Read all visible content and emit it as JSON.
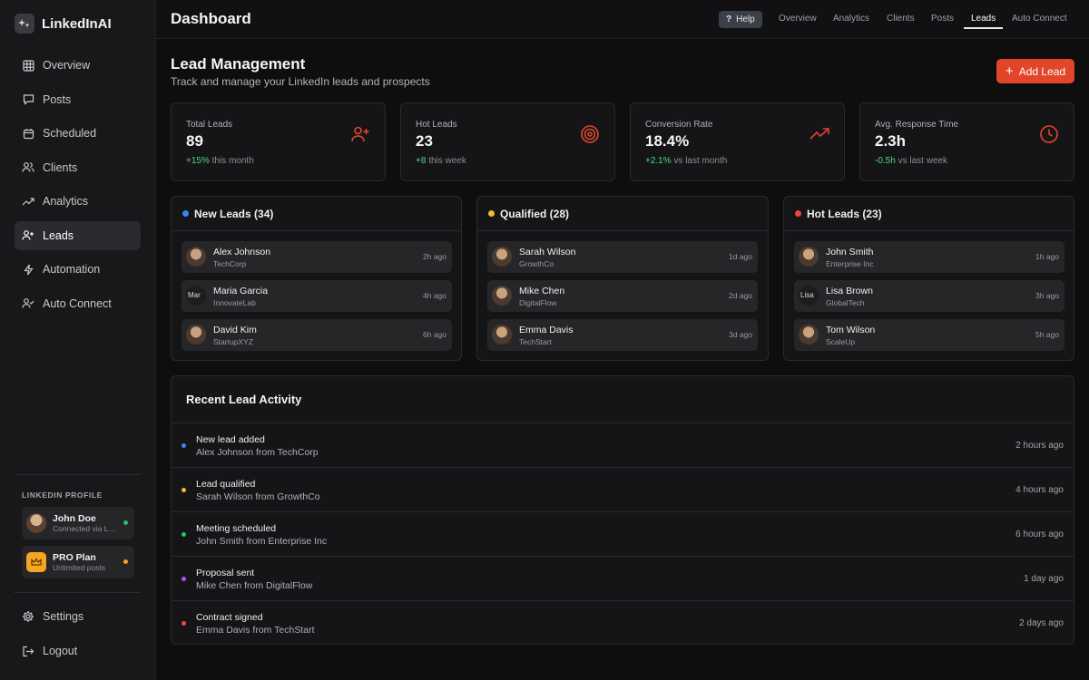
{
  "brand": {
    "name": "LinkedInAI",
    "logo_icon": "sparkle-icon"
  },
  "sidebar": {
    "items": [
      {
        "label": "Overview",
        "icon": "grid-icon",
        "active": false
      },
      {
        "label": "Posts",
        "icon": "chat-bubble-icon",
        "active": false
      },
      {
        "label": "Scheduled",
        "icon": "calendar-icon",
        "active": false
      },
      {
        "label": "Clients",
        "icon": "users-icon",
        "active": false
      },
      {
        "label": "Analytics",
        "icon": "trend-icon",
        "active": false
      },
      {
        "label": "Leads",
        "icon": "user-plus-icon",
        "active": true
      },
      {
        "label": "Automation",
        "icon": "lightning-icon",
        "active": false
      },
      {
        "label": "Auto Connect",
        "icon": "user-check-icon",
        "active": false
      }
    ],
    "profile_section_label": "LINKEDIN PROFILE",
    "profile": {
      "name": "John Doe",
      "status": "Connected via LinkedIn",
      "status_color": "#22c55e"
    },
    "plan": {
      "name": "PRO Plan",
      "detail": "Unlimited posts",
      "status_color": "#f5a623"
    },
    "settings_label": "Settings",
    "logout_label": "Logout"
  },
  "header": {
    "title": "Dashboard",
    "help_label": "Help",
    "tabs": [
      {
        "label": "Overview",
        "active": false
      },
      {
        "label": "Analytics",
        "active": false
      },
      {
        "label": "Clients",
        "active": false
      },
      {
        "label": "Posts",
        "active": false
      },
      {
        "label": "Leads",
        "active": true
      },
      {
        "label": "Auto Connect",
        "active": false
      }
    ]
  },
  "main": {
    "title": "Lead Management",
    "subtitle": "Track and manage your LinkedIn leads and prospects",
    "add_button_label": "Add Lead",
    "accent_color": "#e2452a"
  },
  "stats": [
    {
      "label": "Total Leads",
      "value": "89",
      "change": "+15%",
      "change_suffix": "this month",
      "icon": "user-plus-icon"
    },
    {
      "label": "Hot Leads",
      "value": "23",
      "change": "+8",
      "change_suffix": "this week",
      "icon": "target-icon"
    },
    {
      "label": "Conversion Rate",
      "value": "18.4%",
      "change": "+2.1%",
      "change_suffix": "vs last month",
      "icon": "trending-up-icon"
    },
    {
      "label": "Avg. Response Time",
      "value": "2.3h",
      "change": "-0.5h",
      "change_suffix": "vs last week",
      "icon": "clock-icon"
    }
  ],
  "lead_columns": [
    {
      "title": "New Leads (34)",
      "dot_color": "#3b82f6",
      "leads": [
        {
          "name": "Alex Johnson",
          "company": "TechCorp",
          "time": "2h ago",
          "avatar_alt": ""
        },
        {
          "name": "Maria Garcia",
          "company": "InnovateLab",
          "time": "4h ago",
          "avatar_alt": "Mar"
        },
        {
          "name": "David Kim",
          "company": "StartupXYZ",
          "time": "6h ago",
          "avatar_alt": ""
        }
      ]
    },
    {
      "title": "Qualified (28)",
      "dot_color": "#f5b82e",
      "leads": [
        {
          "name": "Sarah Wilson",
          "company": "GrowthCo",
          "time": "1d ago",
          "avatar_alt": ""
        },
        {
          "name": "Mike Chen",
          "company": "DigitalFlow",
          "time": "2d ago",
          "avatar_alt": ""
        },
        {
          "name": "Emma Davis",
          "company": "TechStart",
          "time": "3d ago",
          "avatar_alt": ""
        }
      ]
    },
    {
      "title": "Hot Leads (23)",
      "dot_color": "#ef4444",
      "leads": [
        {
          "name": "John Smith",
          "company": "Enterprise Inc",
          "time": "1h ago",
          "avatar_alt": ""
        },
        {
          "name": "Lisa Brown",
          "company": "GlobalTech",
          "time": "3h ago",
          "avatar_alt": "Lisa"
        },
        {
          "name": "Tom Wilson",
          "company": "ScaleUp",
          "time": "5h ago",
          "avatar_alt": ""
        }
      ]
    }
  ],
  "activity": {
    "title": "Recent Lead Activity",
    "items": [
      {
        "title": "New lead added",
        "desc": "Alex Johnson from TechCorp",
        "time": "2 hours ago",
        "dot_color": "#3b82f6"
      },
      {
        "title": "Lead qualified",
        "desc": "Sarah Wilson from GrowthCo",
        "time": "4 hours ago",
        "dot_color": "#f5b82e"
      },
      {
        "title": "Meeting scheduled",
        "desc": "John Smith from Enterprise Inc",
        "time": "6 hours ago",
        "dot_color": "#22c55e"
      },
      {
        "title": "Proposal sent",
        "desc": "Mike Chen from DigitalFlow",
        "time": "1 day ago",
        "dot_color": "#a855f7"
      },
      {
        "title": "Contract signed",
        "desc": "Emma Davis from TechStart",
        "time": "2 days ago",
        "dot_color": "#ef4444"
      }
    ]
  }
}
